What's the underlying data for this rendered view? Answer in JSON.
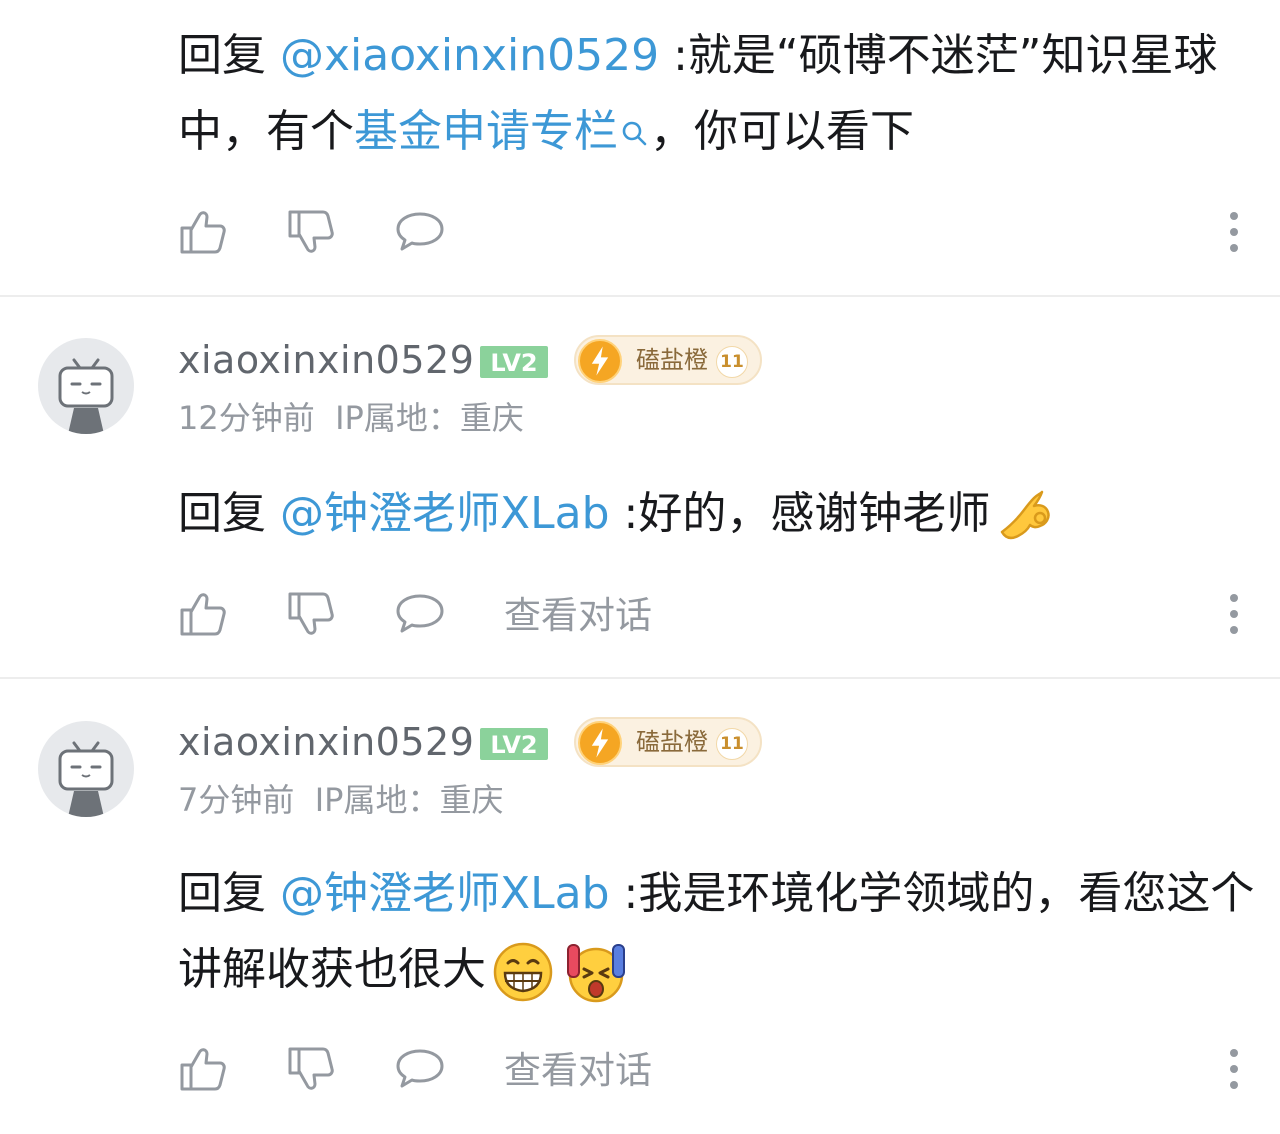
{
  "comments": [
    {
      "reply_prefix": "回复 ",
      "mention": "@xiaoxinxin0529",
      "text_before_link": " :就是“硕博不迷茫”知识星球中，有个",
      "link": "基金申请专栏",
      "text_after_link": "，你可以看下",
      "actions": {
        "like_icon": "thumb-up-icon",
        "dislike_icon": "thumb-down-icon",
        "reply_icon": "comment-icon",
        "more_icon": "more-vertical-icon"
      }
    },
    {
      "username": "xiaoxinxin0529",
      "level_badge": "LV2",
      "fan_medal": {
        "name": "磕盐橙",
        "level": "11"
      },
      "time": "12分钟前",
      "ip": "IP属地：重庆",
      "reply_prefix": "回复 ",
      "mention": "@钟澄老师XLab",
      "text": " :好的，感谢钟老师",
      "emojis": [
        "ok-hand-emoji"
      ],
      "view_conversation": "查看对话"
    },
    {
      "username": "xiaoxinxin0529",
      "level_badge": "LV2",
      "fan_medal": {
        "name": "磕盐橙",
        "level": "11"
      },
      "time": "7分钟前",
      "ip": "IP属地：重庆",
      "reply_prefix": "回复 ",
      "mention": "@钟澄老师XLab",
      "text": " :我是环境化学领域的，看您这个讲解收获也很大",
      "emojis": [
        "grinning-emoji",
        "shocked-emoji"
      ],
      "view_conversation": "查看对话"
    }
  ],
  "colors": {
    "mention": "#3d98d6",
    "secondary_text": "#9499a0",
    "level_green": "#8bd29b",
    "medal_orange": "#f5a623"
  }
}
